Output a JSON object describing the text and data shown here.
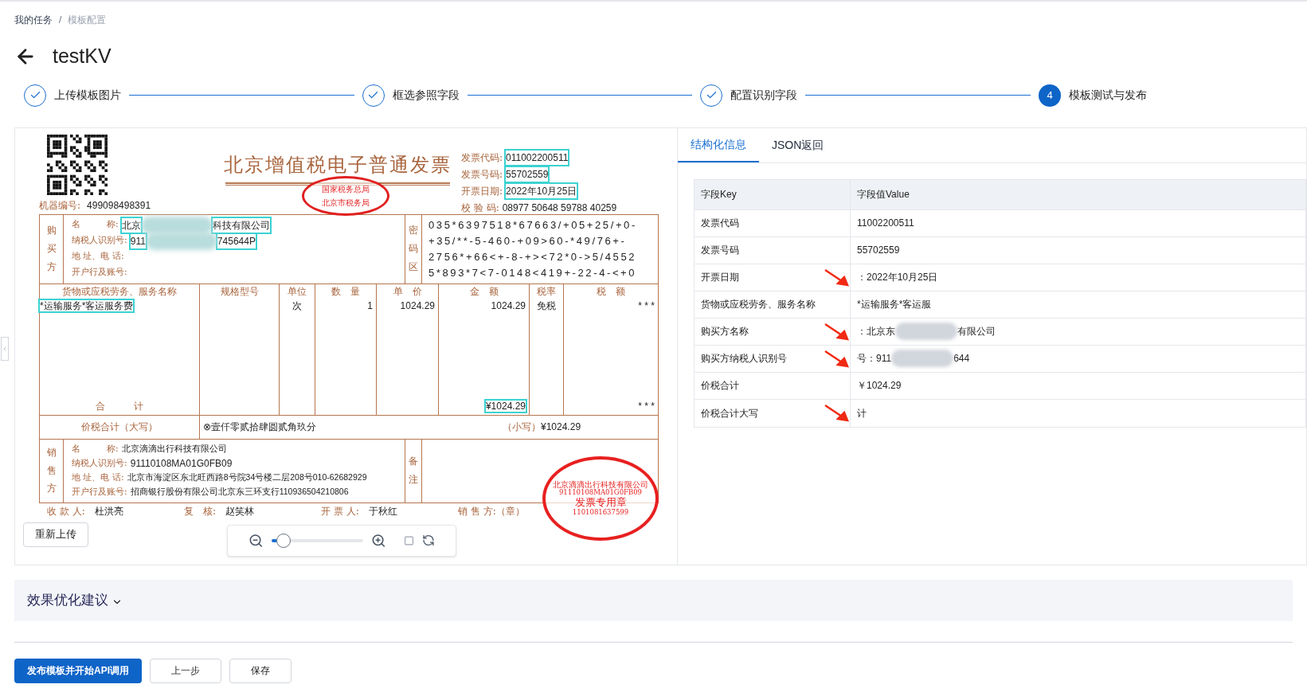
{
  "breadcrumb_separator": "/",
  "breadcrumb": [
    {
      "label": "我的任务",
      "current": false
    },
    {
      "label": "模板配置",
      "current": true
    }
  ],
  "title": "testKV",
  "steps": [
    {
      "label": "上传模板图片",
      "done": true
    },
    {
      "label": "框选参照字段",
      "done": true
    },
    {
      "label": "配置识别字段",
      "done": true
    },
    {
      "label": "模板测试与发布",
      "done": false,
      "number": "4"
    }
  ],
  "invoice": {
    "title": "北京增值税电子普通发票",
    "machine_no": {
      "label": "机器编号:",
      "value": "499098498391"
    },
    "meta": [
      {
        "label": "发票代码:",
        "value": "011002200511",
        "highlighted": true
      },
      {
        "label": "发票号码:",
        "value": "55702559",
        "highlighted": true
      },
      {
        "label": "开票日期:",
        "value": "2022年10月25日",
        "highlighted": true
      },
      {
        "label": "校 验 码:",
        "value": "08977 50648 59788 40259",
        "highlighted": false
      }
    ],
    "tax_stamp": [
      "国家税务总局",
      "北京市税务局"
    ],
    "buyer": {
      "side_label": "购买方",
      "fields": [
        {
          "label": "名　　　称:",
          "parts": [
            "北京",
            "科技有限公司"
          ],
          "highlighted": true
        },
        {
          "label": "纳税人识别号:",
          "parts": [
            "911",
            "745644P"
          ],
          "highlighted": true
        },
        {
          "label": "地 址、电 话:"
        },
        {
          "label": "开户行及账号:"
        }
      ]
    },
    "cipher_label": "密码区",
    "cipher_lines": [
      "035*6397518*67663/+05+25/+0-",
      "+35/**-5-460-+09>60-*49/76+-",
      "2756*+66<+-8-+><72*0->5/4552",
      "5*893*7<7-0148<419+-22-4-<+0"
    ],
    "goods_columns": [
      "货物或应税劳务、服务名称",
      "规格型号",
      "单位",
      "数　量",
      "单　价",
      "金　额",
      "税率",
      "税　额"
    ],
    "goods_rows": [
      {
        "name": "*运输服务*客运服务费",
        "unit": "次",
        "quantity": "1",
        "price": "1024.29",
        "amount": "1024.29",
        "rate": "免税",
        "tax": "* * *",
        "highlighted": true
      }
    ],
    "subtotal": {
      "label": "合　　　计",
      "amount": "¥1024.29",
      "tax": "* * *",
      "highlighted": true
    },
    "total": {
      "label": "价税合计（大写）",
      "words": "⊗壹仟零贰拾肆圆贰角玖分",
      "small_label": "（小写）",
      "small_value": "¥1024.29"
    },
    "seller": {
      "side_label": "销售方",
      "fields": [
        {
          "label": "名　　　称:",
          "value": "北京滴滴出行科技有限公司"
        },
        {
          "label": "纳税人识别号:",
          "value": "91110108MA01G0FB09"
        },
        {
          "label": "地 址、电 话:",
          "value": "北京市海淀区东北旺西路8号院34号楼二层208号010-62682929"
        },
        {
          "label": "开户行及账号:",
          "value": "招商银行股份有限公司北京东三环支行110936504210806"
        }
      ],
      "remark_label": "备注"
    },
    "seller_stamp": [
      "北京滴滴出行科技有限公司",
      "91110108MA01G0FB09",
      "发票专用章",
      "1101081637599"
    ],
    "signatures": [
      {
        "label": "收 款 人:",
        "value": "杜洪亮"
      },
      {
        "label": "复　核:",
        "value": "赵笑林"
      },
      {
        "label": "开 票 人:",
        "value": "于秋红"
      },
      {
        "label": "销 售 方:（章）"
      }
    ]
  },
  "viewer": {
    "reupload": "重新上传",
    "zoom": {
      "level": 0.06
    }
  },
  "tabs": [
    {
      "label": "结构化信息",
      "selected": true
    },
    {
      "label": "JSON返回",
      "selected": false
    }
  ],
  "table": {
    "columns": [
      "字段Key",
      "字段值Value"
    ],
    "rows": [
      {
        "key": "发票代码",
        "parts": [
          "11002200511"
        ],
        "marked": false
      },
      {
        "key": "发票号码",
        "parts": [
          "55702559"
        ],
        "marked": false
      },
      {
        "key": "开票日期",
        "parts": [
          "：2022年10月25日"
        ],
        "marked": true
      },
      {
        "key": "货物或应税劳务、服务名称",
        "parts": [
          "*运输服务*客运服"
        ],
        "marked": false
      },
      {
        "key": "购买方名称",
        "parts": [
          "：北京东",
          "有限公司"
        ],
        "marked": true
      },
      {
        "key": "购买方纳税人识别号",
        "parts": [
          "号：911",
          "644"
        ],
        "marked": true
      },
      {
        "key": "价税合计",
        "parts": [
          "￥1024.29"
        ],
        "marked": false
      },
      {
        "key": "价税合计大写",
        "parts": [
          "计"
        ],
        "marked": true
      }
    ]
  },
  "advice": {
    "label": "效果优化建议",
    "expanded": false
  },
  "buttons": [
    {
      "label": "发布模板并开始API调用",
      "kind": "primary"
    },
    {
      "label": "上一步",
      "kind": "default"
    },
    {
      "label": "保存",
      "kind": "default"
    }
  ]
}
